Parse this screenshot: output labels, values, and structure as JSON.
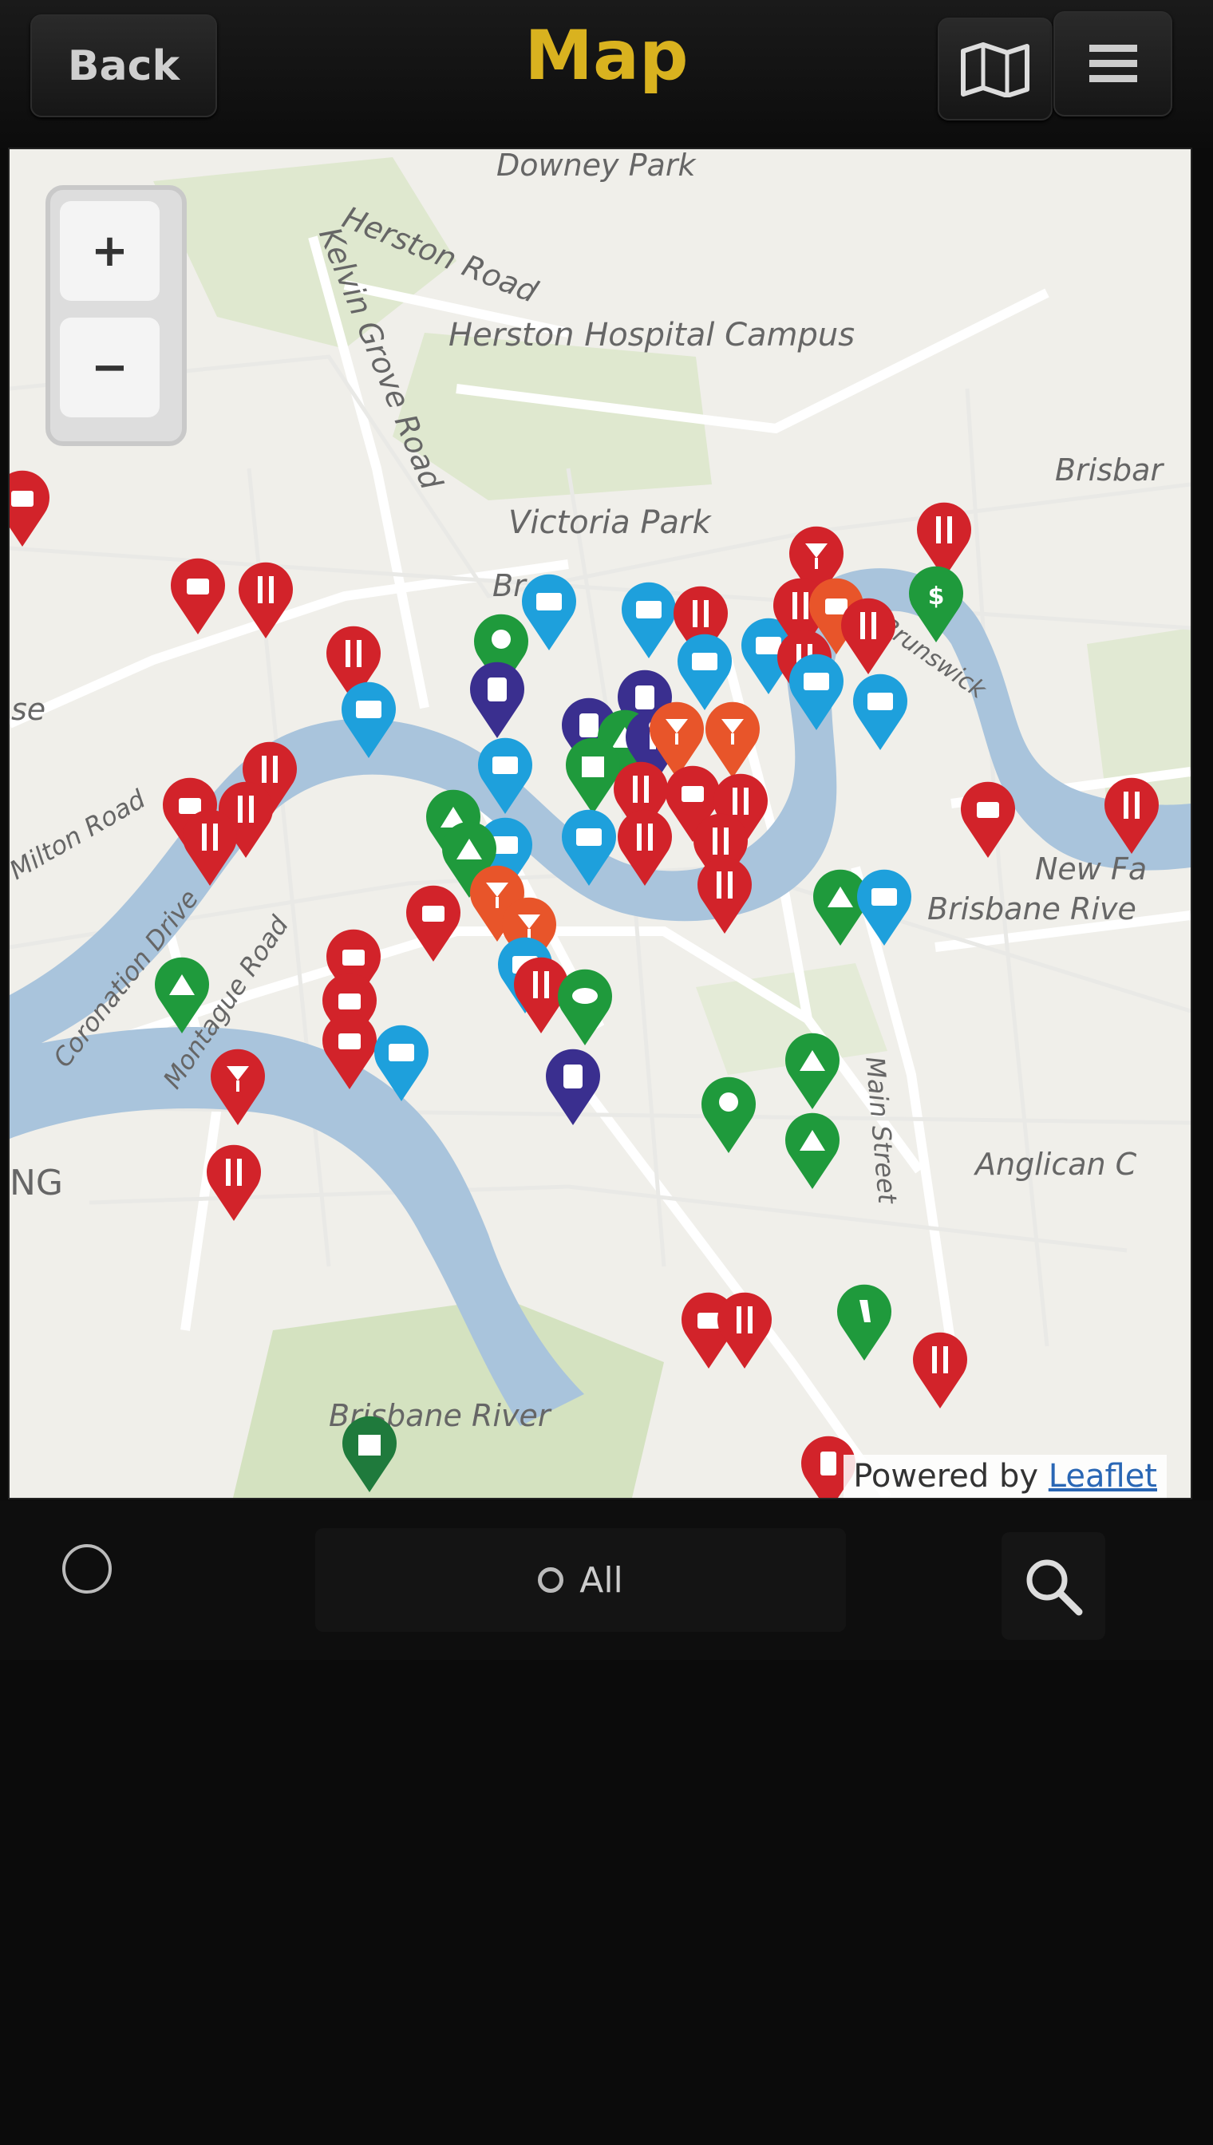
{
  "header": {
    "back_label": "Back",
    "title": "Map",
    "map_icon": "map-icon",
    "menu_icon": "menu-icon"
  },
  "map": {
    "zoom_in": "+",
    "zoom_out": "−",
    "labels": [
      "Downey Park",
      "Herston Road",
      "Kelvin Grove Road",
      "Herston Hospital Campus",
      "Brisbar",
      "Victoria Park",
      "Br",
      "Brunswick",
      "se",
      "Milton Road",
      "Coronation Drive",
      "Montague Road",
      "NG",
      "Main Street",
      "New Fa",
      "Brisbane Rive",
      "Anglican C",
      "Brisbane River"
    ],
    "attribution_prefix": "Powered by ",
    "attribution_link": "Leaflet"
  },
  "bottom": {
    "locate_icon": "locate-icon",
    "filter_label": "All",
    "search_icon": "search-icon"
  },
  "colors": {
    "title": "#d9b21f",
    "red_pin": "#d2232a",
    "blue_pin": "#1ea0dc",
    "green_pin": "#1f9a3c",
    "purple_pin": "#3a2f8f",
    "orange_pin": "#e8552a"
  }
}
